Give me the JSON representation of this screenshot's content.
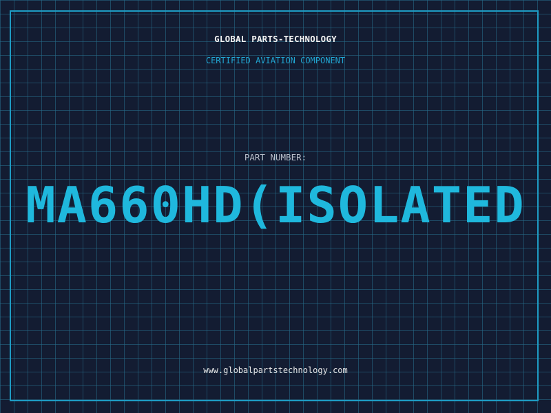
{
  "header": {
    "company": "GLOBAL PARTS-TECHNOLOGY",
    "subtitle": "CERTIFIED AVIATION COMPONENT"
  },
  "part": {
    "label": "PART NUMBER:",
    "number": "MA660HD(ISOLATED"
  },
  "footer": {
    "website": "www.globalpartstechnology.com"
  },
  "colors": {
    "background": "#131c32",
    "grid": "#266e8c",
    "accent": "#1fb8dd",
    "frame": "#1e9cc4"
  }
}
